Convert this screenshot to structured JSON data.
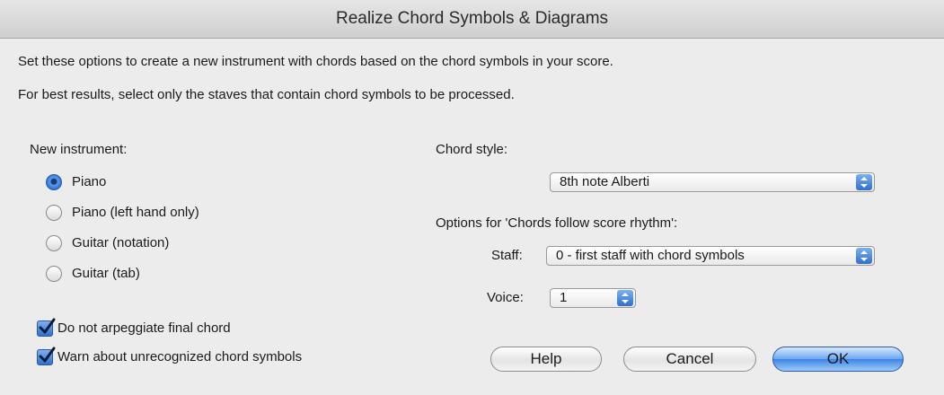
{
  "dialog": {
    "title": "Realize Chord Symbols & Diagrams",
    "intro_1": "Set these options to create a new instrument with chords based on the chord symbols in your score.",
    "intro_2": "For best results, select only the staves that contain chord symbols to be processed."
  },
  "instrument": {
    "label": "New instrument:",
    "options": [
      {
        "label": "Piano",
        "selected": true
      },
      {
        "label": "Piano (left hand only)",
        "selected": false
      },
      {
        "label": "Guitar (notation)",
        "selected": false
      },
      {
        "label": "Guitar (tab)",
        "selected": false
      }
    ]
  },
  "checkboxes": [
    {
      "label": "Do not arpeggiate final chord",
      "checked": true
    },
    {
      "label": "Warn about unrecognized chord symbols",
      "checked": true
    }
  ],
  "chord_style": {
    "label": "Chord style:",
    "value": "8th note Alberti"
  },
  "rhythm_options": {
    "label": "Options for 'Chords follow score rhythm':",
    "staff_label": "Staff:",
    "staff_value": "0 - first staff with chord symbols",
    "voice_label": "Voice:",
    "voice_value": "1"
  },
  "buttons": {
    "help": "Help",
    "cancel": "Cancel",
    "ok": "OK"
  },
  "colors": {
    "accent": "#3f84e4",
    "dialog_bg": "#ececec"
  }
}
